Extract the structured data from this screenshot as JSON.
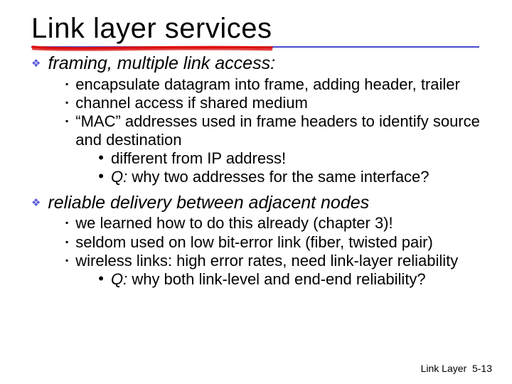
{
  "title": "Link layer services",
  "sections": [
    {
      "heading": "framing, multiple link access:",
      "items": [
        {
          "text": "encapsulate datagram into frame, adding header, trailer"
        },
        {
          "text": "channel access if shared medium"
        },
        {
          "text": "“MAC” addresses used in frame headers to identify source and destination",
          "subitems": [
            {
              "text": "different from IP address!"
            },
            {
              "q": "Q:",
              "text": " why two addresses for the same interface?"
            }
          ]
        }
      ]
    },
    {
      "heading": "reliable delivery between adjacent nodes",
      "items": [
        {
          "text": "we learned how to do this already (chapter 3)!"
        },
        {
          "text": "seldom used on low bit-error link (fiber, twisted pair)"
        },
        {
          "text": "wireless links: high error rates, need link-layer reliability",
          "subitems": [
            {
              "q": "Q:",
              "text": " why both link-level and end-end reliability?"
            }
          ]
        }
      ]
    }
  ],
  "footer": {
    "label": "Link Layer",
    "page": "5-13"
  }
}
